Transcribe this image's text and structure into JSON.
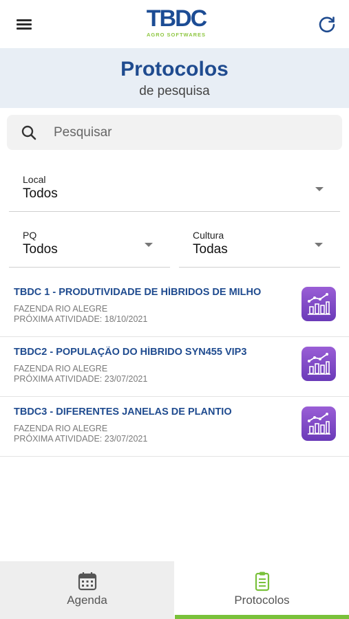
{
  "topbar": {
    "logo_text": "TBDC",
    "logo_sub": "AGRO SOFTWARES",
    "menu_icon": "menu-icon",
    "refresh_icon": "refresh-icon"
  },
  "header": {
    "title": "Protocolos",
    "subtitle": "de pesquisa"
  },
  "search": {
    "placeholder": "Pesquisar",
    "value": ""
  },
  "filters": {
    "local": {
      "label": "Local",
      "value": "Todos"
    },
    "pq": {
      "label": "PQ",
      "value": "Todos"
    },
    "cultura": {
      "label": "Cultura",
      "value": "Todas"
    }
  },
  "protocols": [
    {
      "title": "TBDC 1 - PRODUTIVIDADE DE HÍBRIDOS DE MILHO",
      "farm": "FAZENDA RIO ALEGRE",
      "next_activity": "PRÓXIMA ATIVIDADE: 18/10/2021"
    },
    {
      "title": "TBDC2 - POPULAÇÃO DO HÍBRIDO SYN455 VIP3",
      "farm": "FAZENDA RIO ALEGRE",
      "next_activity": "PRÓXIMA ATIVIDADE: 23/07/2021"
    },
    {
      "title": "TBDC3 - DIFERENTES JANELAS DE PLANTIO",
      "farm": "FAZENDA RIO ALEGRE",
      "next_activity": "PRÓXIMA ATIVIDADE: 23/07/2021"
    }
  ],
  "bottom_nav": {
    "items": [
      {
        "label": "Agenda",
        "icon": "calendar-icon"
      },
      {
        "label": "Protocolos",
        "icon": "clipboard-icon"
      }
    ],
    "active": "Protocolos"
  },
  "colors": {
    "primary": "#1f4b8f",
    "accent_green": "#79c13a",
    "chart_button": "#7b46c4",
    "header_bg": "#e8eef5"
  }
}
